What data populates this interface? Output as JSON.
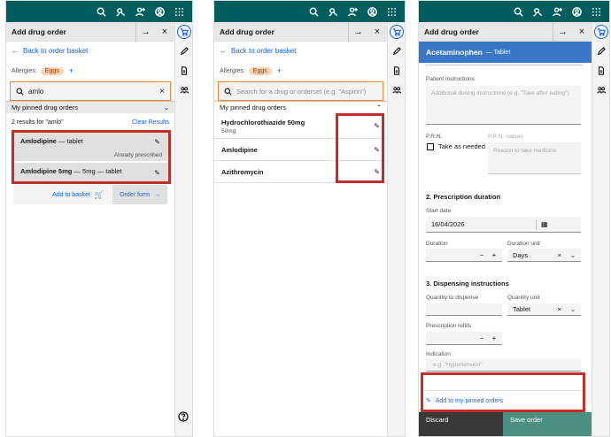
{
  "common": {
    "workspace_title": "Add drug order"
  },
  "panel1": {
    "back_link": "Back to order basket",
    "allergies_label": "Allergies:",
    "allergy_tag": "Eggs",
    "add_allergy": "+",
    "search_value": "amlo",
    "pinned_header": "My pinned drug orders",
    "results_count": "2 results for \"amlo\"",
    "clear_results": "Clear Results",
    "results": [
      {
        "name": "Amlodipine",
        "detail": "— tablet",
        "status": "Already prescribed"
      },
      {
        "name": "Amlodipine 5mg",
        "detail": "— 5mg — tablet",
        "status": ""
      }
    ],
    "add_to_basket": "Add to basket",
    "order_form": "Order form"
  },
  "panel2": {
    "back_link": "Back to order basket",
    "allergies_label": "Allergies:",
    "allergy_tag": "Eggs",
    "add_allergy": "+",
    "search_placeholder": "Search for a drug or orderset (e.g. \"Aspirin\")",
    "pinned_header": "My pinned drug orders",
    "pinned": [
      {
        "name": "Hydrochlorothiazide 50mg",
        "sub": "50mg"
      },
      {
        "name": "Amlodipine",
        "sub": ""
      },
      {
        "name": "Azithromycin",
        "sub": ""
      }
    ]
  },
  "panel3": {
    "drug_name": "Acetaminophen",
    "drug_form": "— Tablet",
    "patient_instructions_label": "Patient instructions",
    "patient_instructions_placeholder": "Additional dosing instructions (e.g. \"Take after eating\")",
    "prn_label": "P.R.N.",
    "take_as_needed": "Take as needed",
    "prn_reason_label": "P.R.N. reason",
    "prn_reason_placeholder": "Reason to take medicine",
    "section_duration": "2. Prescription duration",
    "start_date_label": "Start date",
    "start_date_value": "16/04/2026",
    "duration_label": "Duration",
    "duration_unit_label": "Duration unit",
    "duration_unit_value": "Days",
    "section_dispensing": "3. Dispensing instructions",
    "quantity_label": "Quantity to dispense",
    "quantity_unit_label": "Quantity unit",
    "quantity_unit_value": "Tablet",
    "refills_label": "Prescription refills",
    "indication_label": "Indication",
    "indication_placeholder": "e.g. \"Hypertension\"",
    "add_pinned": "Add to my pinned orders",
    "discard": "Discard",
    "save_order": "Save order"
  },
  "colors": {
    "header_teal": "#005d5d",
    "link_blue": "#0f62fe",
    "highlight_red": "#c32f27",
    "drug_header_blue": "#3a78c7"
  }
}
